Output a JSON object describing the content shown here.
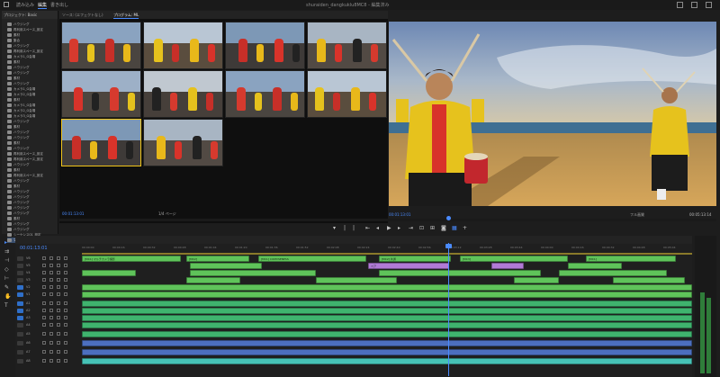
{
  "topbar": {
    "workspaces": [
      "読み込み",
      "編集",
      "書き出し"
    ],
    "active_workspace": "編集",
    "project_title": "shuraiden_dangkuklu8MC8 - 編集済み"
  },
  "project_panel": {
    "tabs": [
      "プロジェクト: Basic",
      "メディア",
      "情報"
    ],
    "bins": [
      "ハウジング",
      "再利用スペース_設定",
      "素材",
      "集合",
      "ハウジング",
      "再利用スペース_設定",
      "カメラ1_G会場",
      "素材",
      "ハウジング",
      "ハウジング",
      "素材",
      "ハウジング",
      "カメラ1_G会場",
      "カメラ2_G会場",
      "素材",
      "カメラ1_G会場",
      "カメラ2_G会場",
      "カメラ3_G会場",
      "ハウジング",
      "素材",
      "ハウジング",
      "ハウジング",
      "素材",
      "ハウジング",
      "再利用スペース_設定",
      "再利用スペース_設定",
      "ハウジング",
      "素材",
      "再利用スペース_設定",
      "ハウジング",
      "素材",
      "ハウジング",
      "ハウジング",
      "ハウジング",
      "ハウジング",
      "ハウジング",
      "素材",
      "ハウジング",
      "ハウジング",
      "シーケンス01_設定",
      "マルチカメラソース"
    ],
    "selected_bin_index": 40
  },
  "source_monitor": {
    "tabs": [
      "ソース: (エフェクトなし)",
      "プログラム: ML"
    ],
    "active_tab_index": 1,
    "timecode": "00:01:13:01",
    "fit": "1/4 ページ",
    "active_camera_index": 8
  },
  "program_monitor": {
    "timecode": "00:01:13:01",
    "fit": "フル画質",
    "duration": "00:05:13:14"
  },
  "transport": {
    "buttons": [
      "mark-in",
      "mark-out",
      "go-to-in",
      "step-back",
      "play",
      "step-forward",
      "go-to-out",
      "insert",
      "overwrite",
      "export-frame",
      "multicam",
      "settings"
    ]
  },
  "timeline": {
    "timecode": "00:01:13:01",
    "ruler_ticks": [
      "00:00:00",
      "00:00:16",
      "00:00:32",
      "00:00:48",
      "00:01:04",
      "00:01:20",
      "00:01:36",
      "00:01:52",
      "00:02:08",
      "00:02:24",
      "00:02:40",
      "00:02:56",
      "00:03:12",
      "00:03:28",
      "00:03:44",
      "00:04:00",
      "00:04:16",
      "00:04:32",
      "00:04:48",
      "00:05:04"
    ],
    "video_tracks": [
      "V6",
      "V5",
      "V4",
      "V3",
      "V2",
      "V1"
    ],
    "audio_tracks": [
      "A1",
      "A2",
      "A3",
      "A4",
      "A5",
      "A6",
      "A7",
      "A8"
    ],
    "clip_labels": [
      "[MC1] マルチカメラ撮影",
      "[MC2]",
      "[MC1] COMVSENESS",
      "[MC2] 共通",
      "[MC3]",
      "[MC1]",
      "ペア"
    ]
  },
  "colors": {
    "accent": "#4a8bff",
    "video_clip": "#5fc35a",
    "nested_clip": "#b17ad6",
    "audio_clip": "#3fb36e",
    "audio_bus": "#4c6fbf",
    "target_track": "#2f6fc9",
    "active_camera_border": "#f0c419"
  }
}
